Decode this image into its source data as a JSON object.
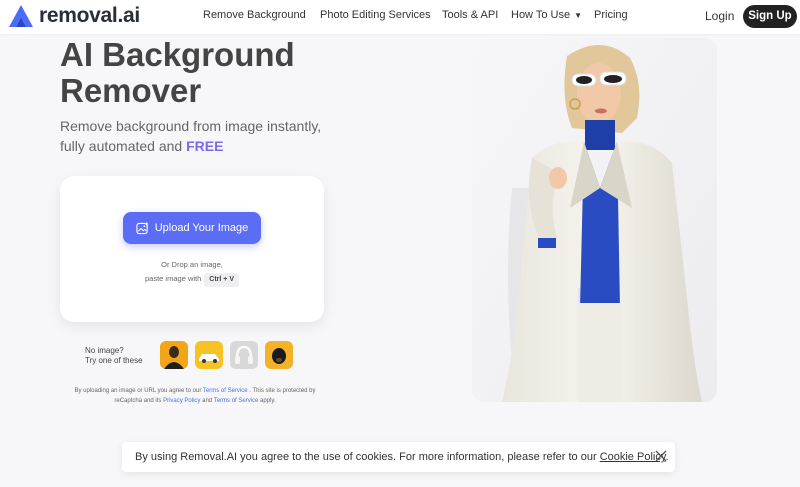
{
  "header": {
    "logo_text": "removal.ai",
    "nav": [
      {
        "label": "Remove Background"
      },
      {
        "label": "Photo Editing Services"
      },
      {
        "label": "Tools & API"
      },
      {
        "label": "How To Use"
      },
      {
        "label": "Pricing"
      }
    ],
    "login_label": "Login",
    "signup_label": "Sign Up"
  },
  "hero": {
    "title_line1": "AI Background",
    "title_line2": "Remover",
    "subtitle_line1": "Remove background from image instantly,",
    "subtitle_line2_prefix": "fully automated and ",
    "subtitle_free": "FREE"
  },
  "upload": {
    "button_label": "Upload Your Image",
    "drop_line1": "Or Drop an image,",
    "drop_line2": "paste image with",
    "shortcut": "Ctrl + V"
  },
  "samples": {
    "label_line1": "No image?",
    "label_line2": "Try one of these"
  },
  "terms": {
    "t1": "By uploading an image or URL you agree to our ",
    "link_tos": "Terms of Service",
    "t2": " . This site is protected by reCaptcha and its ",
    "link_privacy": "Privacy Policy",
    "t3": " and ",
    "link_tos2": "Terms of Service",
    "t4": " apply."
  },
  "cookie": {
    "text": "By using Removal.AI you agree to the use of cookies. For more information, please refer to our ",
    "link": "Cookie Policy",
    "end": "."
  },
  "colors": {
    "brand": "#5b6df5",
    "accent_free": "#7b68ee",
    "link": "#4a6cf7",
    "signup_bg": "#222222"
  }
}
